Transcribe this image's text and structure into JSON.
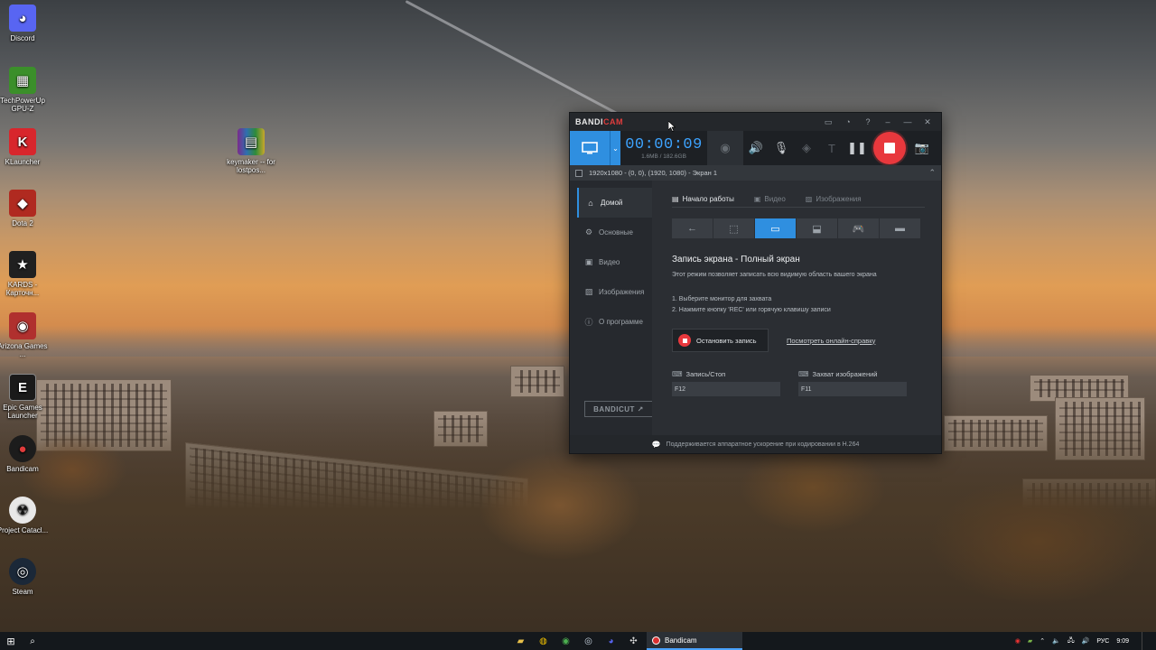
{
  "desktop": {
    "icons": [
      {
        "label": "Discord",
        "glyph": "◕",
        "color": "#5865f2"
      },
      {
        "label": "TechPowerUp GPU-Z",
        "glyph": "▦",
        "color": "#3b8f2a"
      },
      {
        "label": "KLauncher",
        "glyph": "K",
        "color": "#d8262c"
      },
      {
        "label": "Dota 2",
        "glyph": "◆",
        "color": "#b02a20"
      },
      {
        "label": "KARDS - Карточн...",
        "glyph": "★",
        "color": "#202020"
      },
      {
        "label": "Arizona Games ...",
        "glyph": "◉",
        "color": "#b0302e"
      },
      {
        "label": "Epic Games Launcher",
        "glyph": "E",
        "color": "#1a1a1a"
      },
      {
        "label": "Bandicam",
        "glyph": "●",
        "color": "#1c1c1c"
      },
      {
        "label": "Project Catacl...",
        "glyph": "☢",
        "color": "#e8e8e8"
      },
      {
        "label": "Steam",
        "glyph": "◎",
        "color": "#1b2838"
      }
    ],
    "winrar_icon": {
      "label": "keymaker -- for lostpos...",
      "glyph": "▤"
    }
  },
  "bandicam": {
    "logo_part1": "BANDI",
    "logo_part2": "CAM",
    "titlebar_icons": [
      "folder-icon",
      "clock-icon",
      "help-icon",
      "pin-icon",
      "minimize-icon",
      "close-icon"
    ],
    "timer": "00:00:09",
    "size": "1.6MB / 182.6GB",
    "target": "1920x1080 - (0, 0), (1920, 1080) - Экран 1",
    "sidebar": [
      {
        "label": "Домой",
        "icon": "⌂",
        "active": true
      },
      {
        "label": "Основные",
        "icon": "⚙",
        "active": false
      },
      {
        "label": "Видео",
        "icon": "▣",
        "active": false
      },
      {
        "label": "Изображения",
        "icon": "▨",
        "active": false
      },
      {
        "label": "О программе",
        "icon": "ⓘ",
        "active": false
      }
    ],
    "bandicut_label": "BANDICUT ↗",
    "tabs": [
      {
        "label": "Начало работы",
        "icon": "▤",
        "active": true
      },
      {
        "label": "Видео",
        "icon": "▣",
        "active": false
      },
      {
        "label": "Изображения",
        "icon": "▨",
        "active": false
      }
    ],
    "heading": "Запись экрана - Полный экран",
    "description": "Этот режим позволяет записать всю видимую область вашего экрана",
    "step1": "1. Выберите монитор для захвата",
    "step2": "2. Нажмите кнопку 'REC' или горячую клавишу записи",
    "stop_label": "Остановить запись",
    "help_link": "Посмотреть онлайн-справку",
    "hotkey_record_label": "Запись/Стоп",
    "hotkey_record_value": "F12",
    "hotkey_capture_label": "Захват изображений",
    "hotkey_capture_value": "F11",
    "status": "Поддерживается аппаратное ускорение при кодировании в H.264"
  },
  "taskbar": {
    "bandicam_label": "Bandicam",
    "lang": "РУС",
    "time": "9:09"
  }
}
